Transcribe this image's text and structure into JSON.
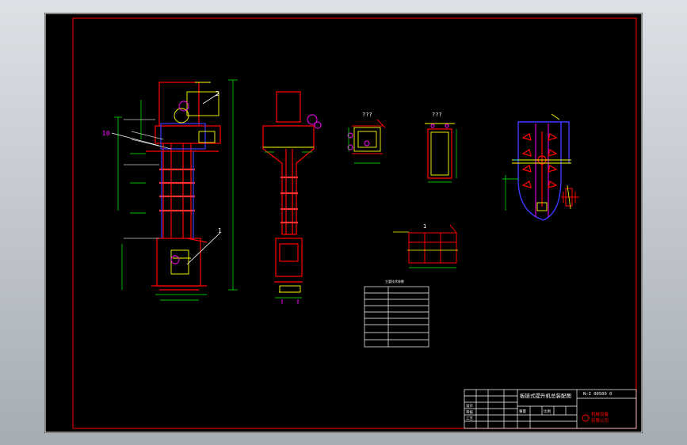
{
  "drawing": {
    "callout_2": "2",
    "callout_10": "10",
    "callout_1": "1",
    "section_label_a": "???",
    "section_label_b": "???",
    "detail_label": "1",
    "table_title": "主要技术参数"
  },
  "title_block": {
    "drawing_title": "板链式提升机总装配图",
    "drawing_code": "N—I 00500 0",
    "weight_label": "重量",
    "scale_label": "比例",
    "row_design": "设计",
    "row_check": "审核",
    "row_process": "工艺",
    "company_line1": "机械设备",
    "company_line2": "有限公司"
  },
  "colors": {
    "border": "#ffffff",
    "frame_red": "#ff0000",
    "line_yellow": "#ffff00",
    "line_blue": "#3a3aff",
    "line_cyan": "#00ffff",
    "line_magenta": "#ff00ff"
  }
}
